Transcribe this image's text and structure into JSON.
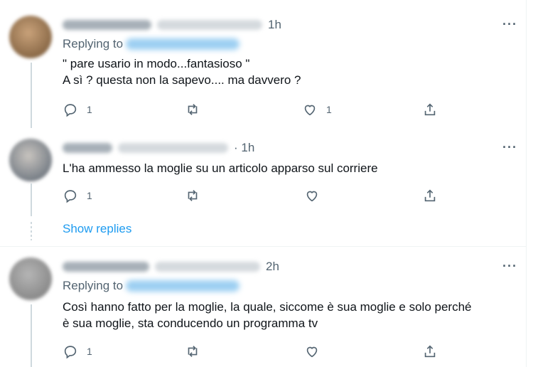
{
  "tweets": [
    {
      "time": "1h",
      "replying_prefix": "Replying to",
      "lines": [
        "\" pare usario in modo...fantasioso \"",
        "A sì ? questa non la sapevo.... ma davvero ?"
      ],
      "reply_count": "1",
      "retweet_count": "",
      "like_count": "1",
      "avatar_color": "#a57c55"
    },
    {
      "time": "· 1h",
      "lines": [
        "L'ha ammesso la moglie su un articolo apparso sul corriere"
      ],
      "reply_count": "1",
      "retweet_count": "",
      "like_count": "",
      "avatar_color": "#8a8f96"
    },
    {
      "time": "2h",
      "replying_prefix": "Replying to",
      "lines": [
        "Così hanno fatto per la moglie, la quale, siccome è sua moglie e solo perché",
        "è sua moglie, sta conducendo un programma tv"
      ],
      "reply_count": "1",
      "retweet_count": "",
      "like_count": "",
      "avatar_color": "#9c9c9c"
    }
  ],
  "show_replies": "Show replies",
  "more_label": "···",
  "colors": {
    "link": "#1d9bf0",
    "muted": "#536471",
    "text": "#0f1419",
    "divider": "#eff3f4"
  },
  "icons": [
    "reply-icon",
    "retweet-icon",
    "like-icon",
    "share-icon",
    "more-icon"
  ]
}
